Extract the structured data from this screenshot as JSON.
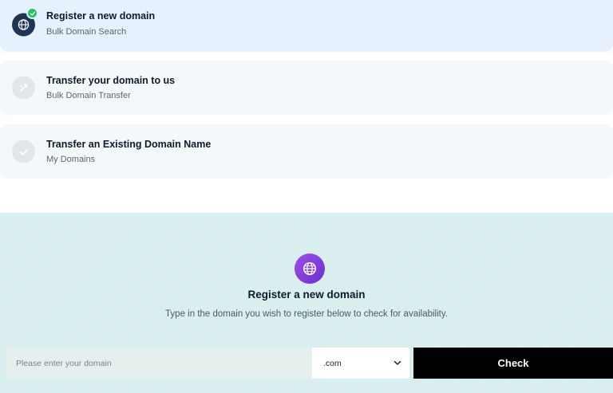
{
  "options": [
    {
      "title": "Register a new domain",
      "subtitle": "Bulk Domain Search",
      "icon": "globe-icon",
      "selected": true
    },
    {
      "title": "Transfer your domain to us",
      "subtitle": "Bulk Domain Transfer",
      "icon": "transfer-icon",
      "selected": false
    },
    {
      "title": "Transfer an Existing Domain Name",
      "subtitle": "My Domains",
      "icon": "check-icon",
      "selected": false
    }
  ],
  "panel": {
    "icon": "globe-icon",
    "title": "Register a new domain",
    "description": "Type in the domain you wish to register below to check for availability."
  },
  "search": {
    "placeholder": "Please enter your domain",
    "value": "",
    "tld": ".com",
    "button_label": "Check"
  },
  "colors": {
    "selected_bg": "#e6f1fd",
    "option_bg": "#f5f8fa",
    "panel_bg": "#d9eeee",
    "accent_purple": "#8b3fe0",
    "success_green": "#22c55e",
    "button_bg": "#000000"
  }
}
